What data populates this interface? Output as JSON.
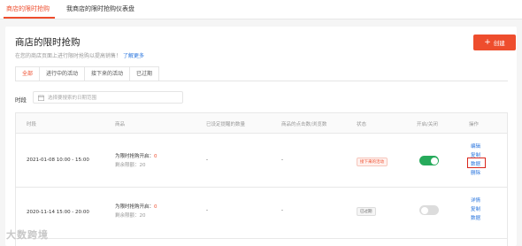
{
  "top_tabs": {
    "active": "商店的限时抢购",
    "dashboard": "我商店的限时抢购仪表盘"
  },
  "header": {
    "title": "商店的限时抢购",
    "description": "在您的商店页面上进行限时抢购以提高销售！",
    "learn_more": "了解更多",
    "create_label": "创建",
    "create_icon": "+"
  },
  "tabs": {
    "all": "全部",
    "ongoing": "进行中的活动",
    "upcoming": "接下来的活动",
    "expired": "已过期"
  },
  "filter": {
    "label": "时段",
    "placeholder": "选择要搜索的日期范围"
  },
  "table": {
    "columns": {
      "period": "时段",
      "product": "商品",
      "reminders": "已设定提醒的数量",
      "clicks": "商品的点击数/浏览数",
      "status": "状态",
      "enabled": "开启/关闭",
      "actions": "操作"
    },
    "rows": [
      {
        "period": "2021-01-08 10:00 - 15:00",
        "product_label": "为限时抢购开启：",
        "product_count": "0",
        "remaining_label": "剩余限额：",
        "remaining_count": "20",
        "reminders": "-",
        "clicks": "-",
        "status": "接下来的活动",
        "enabled": true,
        "actions": {
          "edit": "编辑",
          "copy": "复制",
          "data": "数据",
          "delete": "删除"
        }
      },
      {
        "period": "2020-11-14 15:00 - 20:00",
        "product_label": "为限时抢购开启：",
        "product_count": "0",
        "remaining_label": "剩余限额：",
        "remaining_count": "20",
        "reminders": "-",
        "clicks": "-",
        "status": "已过期",
        "enabled": false,
        "actions": {
          "details": "详情",
          "copy": "复制",
          "data": "数据"
        }
      }
    ]
  },
  "watermark": "大数跨境",
  "colors": {
    "accent": "#ee4d2d",
    "link": "#2673dd",
    "toggle_on": "#26aa5b",
    "highlight": "#d9261c"
  },
  "icons": {
    "calendar": "calendar-icon",
    "plus": "plus-icon"
  }
}
